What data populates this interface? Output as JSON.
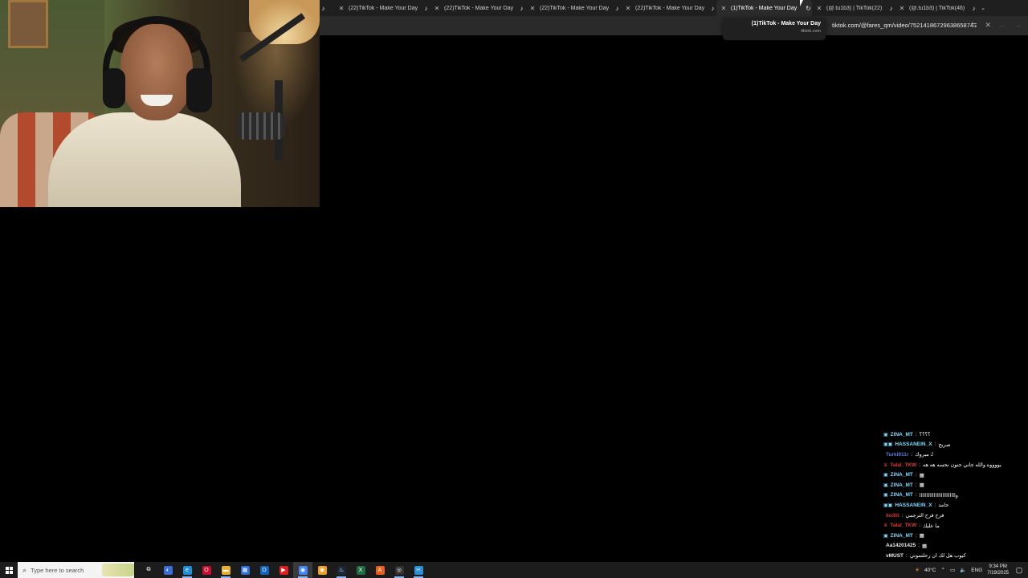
{
  "browser": {
    "tabs": [
      {
        "favicon": "tiktok-icon",
        "label": "(22)TikTok - Make Your Day",
        "active": false
      },
      {
        "favicon": "tiktok-icon",
        "label": "(22)TikTok - Make Your Day",
        "active": false
      },
      {
        "favicon": "tiktok-icon",
        "label": "(22)TikTok - Make Your Day",
        "active": false
      },
      {
        "favicon": "tiktok-icon",
        "label": "(22)TikTok - Make Your Day",
        "active": false
      },
      {
        "favicon": "tiktok-icon",
        "label": "(1)TikTok - Make Your Day",
        "active": true
      },
      {
        "favicon": "tiktok-icon",
        "label": "(@.tu1b3) | TikTok(22)",
        "active": false
      },
      {
        "favicon": "tiktok-icon",
        "label": "(@.tu1b3) | TikTok(46)",
        "active": false
      }
    ],
    "url": "tiktok.com/@fares_qm/video/7521418672963865874",
    "tooltip": {
      "title": "(1)TikTok - Make Your Day",
      "domain": "tiktok.com"
    }
  },
  "chat": {
    "messages": [
      {
        "user": "ZINA_MT",
        "text": "؟؟؟؟",
        "color": "#7fdcff",
        "badge": "▣"
      },
      {
        "user": "HASSANEIN_X",
        "text": "صريح",
        "color": "#7fdcff",
        "badge": "▣▣"
      },
      {
        "user": "Turki911r",
        "text": "مبروك J",
        "color": "#5b7bd8",
        "badge": ""
      },
      {
        "user": "Talal_TKW",
        "text": "يووووه والله جاني جنون نحسه هه هه",
        "color": "#d83b3b",
        "badge": "♛"
      },
      {
        "user": "ZINA_MT",
        "text": "▦",
        "color": "#7fdcff",
        "badge": "▣"
      },
      {
        "user": "ZINA_MT",
        "text": "▦",
        "color": "#7fdcff",
        "badge": "▣"
      },
      {
        "user": "ZINA_MT",
        "text": "وااااااااااااااااااااااااا",
        "color": "#7fdcff",
        "badge": "▣"
      },
      {
        "user": "HASSANEIN_X",
        "text": "جامد",
        "color": "#7fdcff",
        "badge": "▣▣"
      },
      {
        "user": "lio3lil",
        "text": "فرح فرح الترجمي",
        "color": "#d83b3b",
        "badge": ""
      },
      {
        "user": "Talal_TKW",
        "text": "ما عليك",
        "color": "#d83b3b",
        "badge": "♛"
      },
      {
        "user": "ZINA_MT",
        "text": "▦",
        "color": "#7fdcff",
        "badge": "▣"
      },
      {
        "user": "Aa14201425",
        "text": "▦",
        "color": "#e8e8e8",
        "badge": ""
      },
      {
        "user": "vMUST",
        "text": "كيوب هل لك ان رحلتموني",
        "color": "#e8e8e8",
        "badge": ""
      }
    ]
  },
  "taskbar": {
    "search_placeholder": "Type here to search",
    "apps": [
      {
        "icon": "task-view-icon",
        "color": "#1c1c1c",
        "glyph": "⧉"
      },
      {
        "icon": "copilot-icon",
        "color": "#3b6fd8",
        "glyph": "◐"
      },
      {
        "icon": "edge-icon",
        "color": "#1d8fd8",
        "glyph": "e"
      },
      {
        "icon": "opera-icon",
        "color": "#c8102e",
        "glyph": "O"
      },
      {
        "icon": "file-explorer-icon",
        "color": "#e8b030",
        "glyph": "▬"
      },
      {
        "icon": "store-icon",
        "color": "#2b6fd8",
        "glyph": "▦"
      },
      {
        "icon": "outlook-icon",
        "color": "#1065c0",
        "glyph": "O"
      },
      {
        "icon": "youtube-icon",
        "color": "#e02020",
        "glyph": "▶"
      },
      {
        "icon": "chrome-icon",
        "color": "#4285f4",
        "glyph": "◉"
      },
      {
        "icon": "chrome-canary-icon",
        "color": "#f0a020",
        "glyph": "◉"
      },
      {
        "icon": "steam-icon",
        "color": "#1b2838",
        "glyph": "♨"
      },
      {
        "icon": "excel-icon",
        "color": "#1d6f42",
        "glyph": "X"
      },
      {
        "icon": "acrobat-icon",
        "color": "#e8601c",
        "glyph": "A"
      },
      {
        "icon": "obs-icon",
        "color": "#303030",
        "glyph": "◎"
      },
      {
        "icon": "snipping-tool-icon",
        "color": "#2a8fd8",
        "glyph": "✂"
      }
    ],
    "weather": "40°C",
    "language": "ENG",
    "time": "9:34 PM",
    "date": "7/19/2025"
  }
}
